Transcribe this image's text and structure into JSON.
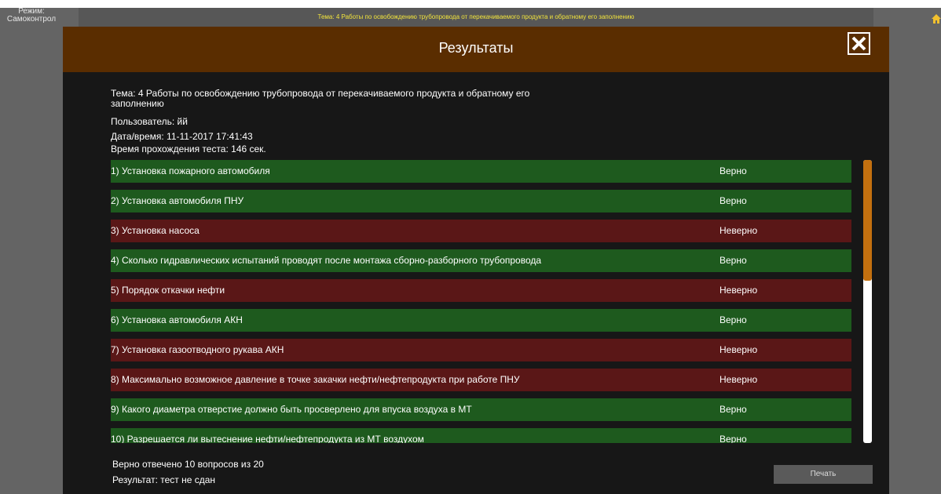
{
  "mode": {
    "label_line1": "Режим:",
    "label_line2": "Самоконтрол"
  },
  "theme_bar": {
    "text": "Тема: 4 Работы по освобождению трубопровода от перекачиваемого продукта и обратному его заполнению"
  },
  "modal": {
    "title": "Результаты",
    "info": {
      "topic_line1": "Тема: 4 Работы по освобождению трубопровода от перекачиваемого продукта и обратному его",
      "topic_line2": "заполнению",
      "user": "Пользователь: йй",
      "datetime": "Дата/время: 11-11-2017 17:41:43",
      "duration": "Время прохождения теста: 146 сек."
    },
    "questions": [
      {
        "text": "1) Установка пожарного автомобиля",
        "result": "Верно",
        "status": "correct"
      },
      {
        "text": "2) Установка автомобиля ПНУ",
        "result": "Верно",
        "status": "correct"
      },
      {
        "text": "3) Установка насоса",
        "result": "Неверно",
        "status": "wrong"
      },
      {
        "text": "4) Сколько гидравлических испытаний проводят после монтажа сборно-разборного трубопровода",
        "result": "Верно",
        "status": "correct"
      },
      {
        "text": "5) Порядок откачки нефти",
        "result": "Неверно",
        "status": "wrong"
      },
      {
        "text": "6) Установка автомобиля АКН",
        "result": "Верно",
        "status": "correct"
      },
      {
        "text": "7) Установка газоотводного рукава АКН",
        "result": "Неверно",
        "status": "wrong"
      },
      {
        "text": "8) Максимально возможное давление в точке закачки нефти/нефтепродукта при работе ПНУ",
        "result": "Неверно",
        "status": "wrong"
      },
      {
        "text": "9) Какого диаметра отверстие должно быть просверлено для впуска воздуха в МТ",
        "result": "Верно",
        "status": "correct"
      },
      {
        "text": "10) Разрешается ли вытеснение нефти/нефтепродукта из МТ воздухом",
        "result": "Верно",
        "status": "correct"
      }
    ],
    "summary": {
      "correct_count": "Верно отвечено 10 вопросов из 20",
      "result": "Результат: тест не сдан"
    },
    "print_label": "Печать"
  },
  "colors": {
    "correct": "#1e5a1e",
    "wrong": "#5a1717",
    "header": "#5a2d00",
    "accent": "#c3700f"
  },
  "icons": {
    "close": "close-icon",
    "home": "home-icon"
  }
}
